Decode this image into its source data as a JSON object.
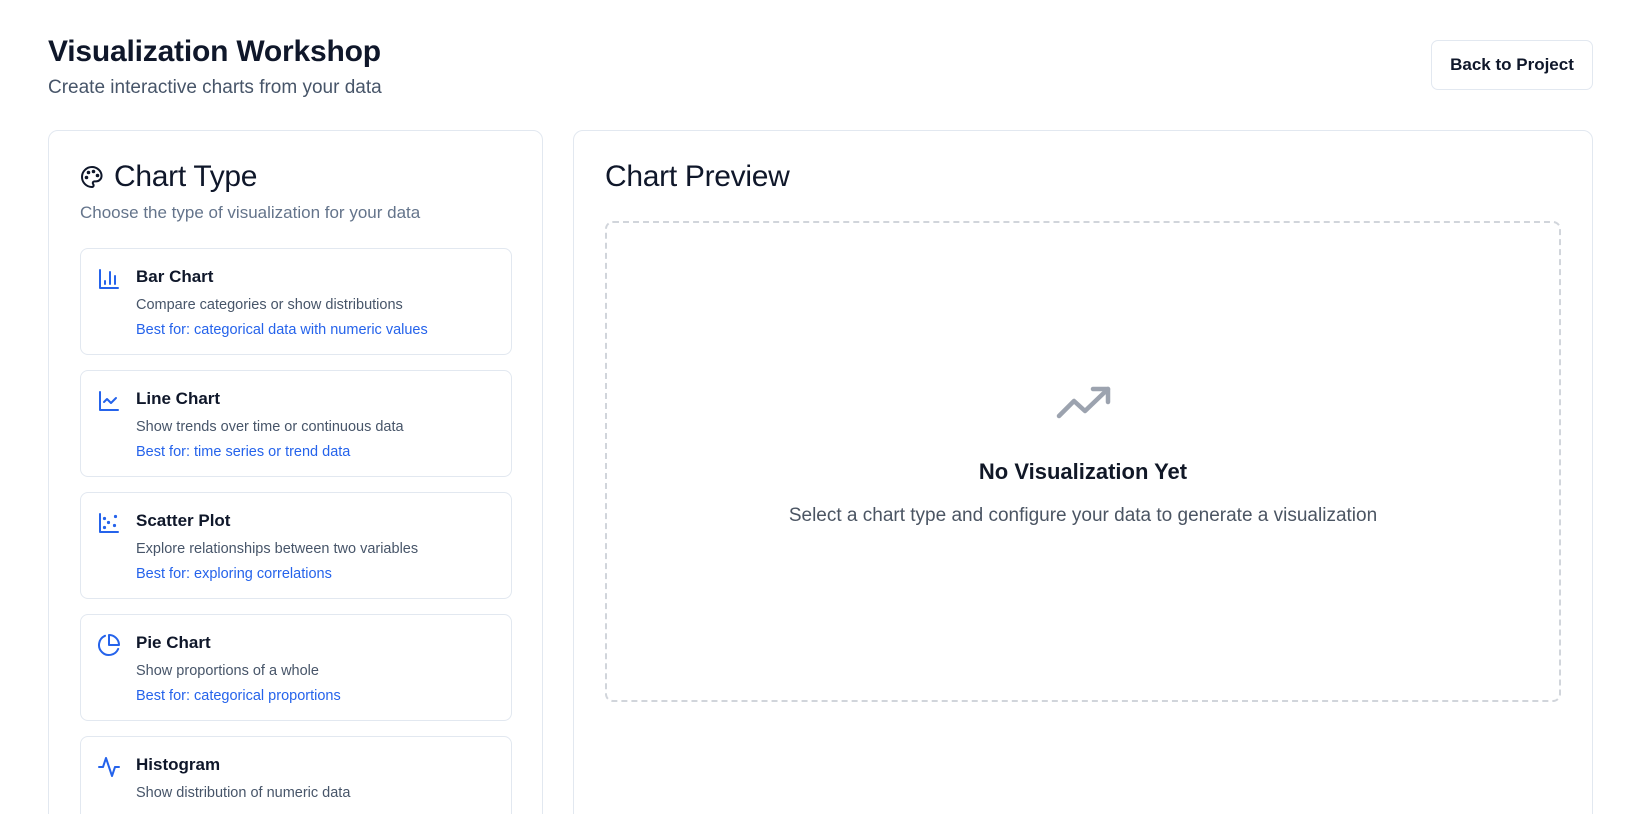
{
  "header": {
    "title": "Visualization Workshop",
    "subtitle": "Create interactive charts from your data",
    "back_button": "Back to Project"
  },
  "chart_type_panel": {
    "title": "Chart Type",
    "description": "Choose the type of visualization for your data",
    "icon": "palette-icon",
    "options": [
      {
        "name": "Bar Chart",
        "icon": "bar-chart-icon",
        "description": "Compare categories or show distributions",
        "best_for": "Best for: categorical data with numeric values"
      },
      {
        "name": "Line Chart",
        "icon": "line-chart-icon",
        "description": "Show trends over time or continuous data",
        "best_for": "Best for: time series or trend data"
      },
      {
        "name": "Scatter Plot",
        "icon": "scatter-plot-icon",
        "description": "Explore relationships between two variables",
        "best_for": "Best for: exploring correlations"
      },
      {
        "name": "Pie Chart",
        "icon": "pie-chart-icon",
        "description": "Show proportions of a whole",
        "best_for": "Best for: categorical proportions"
      },
      {
        "name": "Histogram",
        "icon": "activity-icon",
        "description": "Show distribution of numeric data",
        "best_for": ""
      }
    ]
  },
  "preview_panel": {
    "title": "Chart Preview",
    "empty_icon": "trending-up-icon",
    "empty_title": "No Visualization Yet",
    "empty_description": "Select a chart type and configure your data to generate a visualization"
  },
  "colors": {
    "accent": "#2563eb",
    "border": "#e2e8f0",
    "muted_text": "#64748b",
    "empty_icon": "#9ca3af"
  }
}
